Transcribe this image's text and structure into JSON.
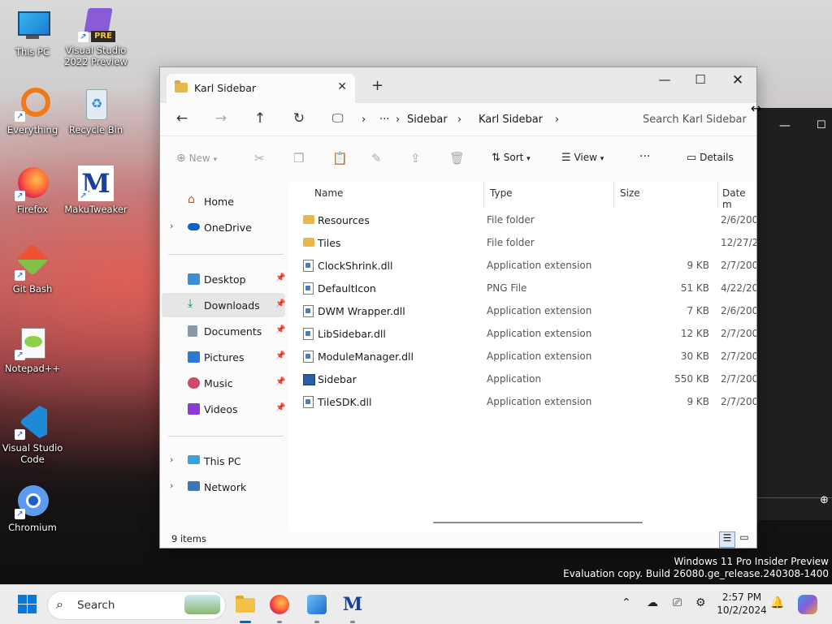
{
  "desktop": {
    "icons": [
      {
        "label": "This PC"
      },
      {
        "label": "Visual Studio 2022 Preview",
        "badge": "PRE"
      },
      {
        "label": "Everything"
      },
      {
        "label": "Recycle Bin"
      },
      {
        "label": "Firefox"
      },
      {
        "label": "MakuTweaker"
      },
      {
        "label": "Git Bash"
      },
      {
        "label": "Notepad++"
      },
      {
        "label": "Visual Studio Code"
      },
      {
        "label": "Chromium"
      }
    ]
  },
  "window": {
    "tab_title": "Karl Sidebar",
    "nav": {
      "breadcrumb": [
        "Sidebar",
        "Karl Sidebar"
      ],
      "overflow": "···",
      "search_placeholder": "Search Karl Sidebar"
    },
    "commands": {
      "new_label": "New",
      "sort_label": "Sort",
      "view_label": "View",
      "more_label": "···",
      "details_label": "Details"
    },
    "sidebar": {
      "items": [
        {
          "label": "Home"
        },
        {
          "label": "OneDrive"
        },
        {
          "label": "Desktop"
        },
        {
          "label": "Downloads"
        },
        {
          "label": "Documents"
        },
        {
          "label": "Pictures"
        },
        {
          "label": "Music"
        },
        {
          "label": "Videos"
        },
        {
          "label": "This PC"
        },
        {
          "label": "Network"
        }
      ]
    },
    "columns": {
      "name": "Name",
      "type": "Type",
      "size": "Size",
      "date": "Date m"
    },
    "files": [
      {
        "name": "Resources",
        "type": "File folder",
        "size": "",
        "date": "2/6/200",
        "kind": "folder"
      },
      {
        "name": "Tiles",
        "type": "File folder",
        "size": "",
        "date": "12/27/2",
        "kind": "folder"
      },
      {
        "name": "ClockShrink.dll",
        "type": "Application extension",
        "size": "9 KB",
        "date": "2/7/200",
        "kind": "file"
      },
      {
        "name": "DefaultIcon",
        "type": "PNG File",
        "size": "51 KB",
        "date": "4/22/20",
        "kind": "file"
      },
      {
        "name": "DWM Wrapper.dll",
        "type": "Application extension",
        "size": "7 KB",
        "date": "2/6/200",
        "kind": "file"
      },
      {
        "name": "LibSidebar.dll",
        "type": "Application extension",
        "size": "12 KB",
        "date": "2/7/200",
        "kind": "file"
      },
      {
        "name": "ModuleManager.dll",
        "type": "Application extension",
        "size": "30 KB",
        "date": "2/7/200",
        "kind": "file"
      },
      {
        "name": "Sidebar",
        "type": "Application",
        "size": "550 KB",
        "date": "2/7/200",
        "kind": "app"
      },
      {
        "name": "TileSDK.dll",
        "type": "Application extension",
        "size": "9 KB",
        "date": "2/7/200",
        "kind": "file"
      }
    ],
    "status": {
      "count": "9 items"
    }
  },
  "watermark": {
    "line1": "Windows 11 Pro Insider Preview",
    "line2": "Evaluation copy. Build 26080.ge_release.240308-1400"
  },
  "taskbar": {
    "search_label": "Search",
    "time": "2:57 PM",
    "date": "10/2/2024"
  }
}
